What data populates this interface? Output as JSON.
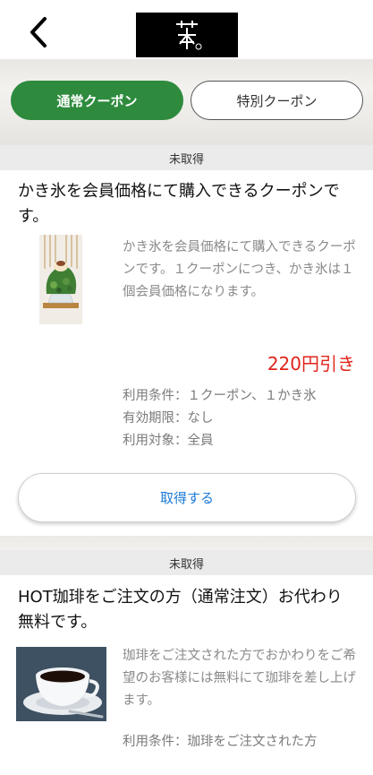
{
  "tabs": {
    "normal": "通常クーポン",
    "special": "特別クーポン"
  },
  "coupons": [
    {
      "status": "未取得",
      "title": "かき氷を会員価格にて購入できるクーポンです。",
      "description": "かき氷を会員価格にて購入できるクーポンです。１クーポンにつき、かき氷は１個会員価格になります。",
      "discount": "220円引き",
      "conditions": "利用条件：１クーポン、１かき氷",
      "validity": "有効期限：なし",
      "target": "利用対象：全員",
      "button": "取得する",
      "image_icon": "shaved-ice-image"
    },
    {
      "status": "未取得",
      "title": "HOT珈琲をご注文の方（通常注文）お代わり無料です。",
      "description": "珈琲をご注文された方でおかわりをご希望のお客様には無料にて珈琲を差し上げます。",
      "conditions": "利用条件：珈琲をご注文された方",
      "image_icon": "coffee-cup-image"
    }
  ],
  "colors": {
    "tab_active": "#2e8b3e",
    "discount": "#e0241b",
    "button_text": "#1a7ad6"
  }
}
